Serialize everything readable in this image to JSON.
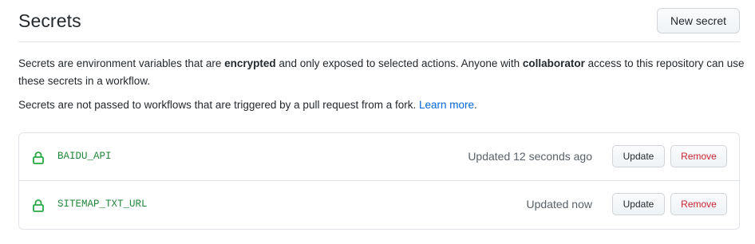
{
  "header": {
    "title": "Secrets",
    "new_secret_label": "New secret"
  },
  "description": {
    "p1_part1": "Secrets are environment variables that are ",
    "p1_bold1": "encrypted",
    "p1_part2": " and only exposed to selected actions. Anyone with ",
    "p1_bold2": "collaborator",
    "p1_part3": " access to this repository can use these secrets in a workflow.",
    "p2_text": "Secrets are not passed to workflows that are triggered by a pull request from a fork. ",
    "p2_link": "Learn more",
    "p2_end": "."
  },
  "secrets": [
    {
      "name": "BAIDU_API",
      "updated": "Updated 12 seconds ago",
      "update_label": "Update",
      "remove_label": "Remove"
    },
    {
      "name": "SITEMAP_TXT_URL",
      "updated": "Updated now",
      "update_label": "Update",
      "remove_label": "Remove"
    }
  ],
  "icons": {
    "lock": "lock-icon"
  },
  "colors": {
    "secret_name": "#22863a",
    "link": "#0366d6",
    "remove": "#cb2431",
    "lock_icon": "#28a745"
  }
}
